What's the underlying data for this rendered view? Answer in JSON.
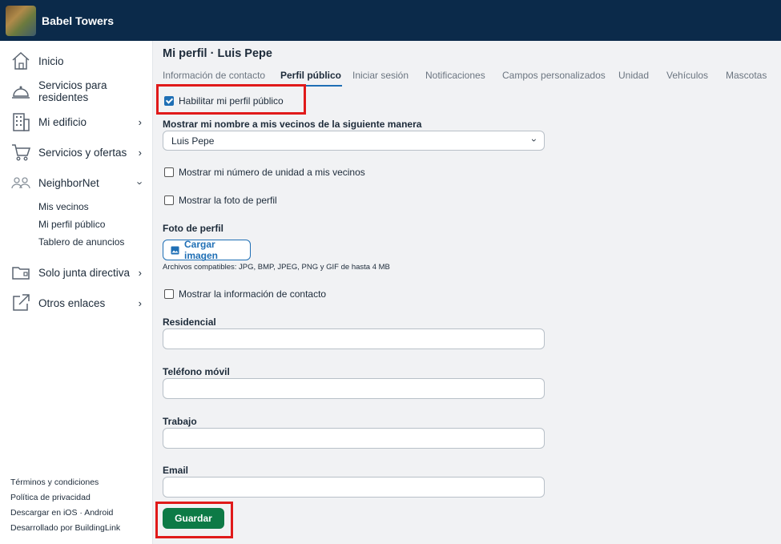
{
  "app": {
    "title": "Babel Towers"
  },
  "sidebar": {
    "items": [
      {
        "label": "Inicio",
        "icon": "home-icon"
      },
      {
        "label": "Servicios para residentes",
        "icon": "bell-icon"
      },
      {
        "label": "Mi edificio",
        "icon": "building-icon"
      },
      {
        "label": "Servicios y ofertas",
        "icon": "cart-icon"
      },
      {
        "label": "NeighborNet",
        "icon": "people-icon"
      },
      {
        "label": "Solo junta directiva",
        "icon": "folder-icon"
      },
      {
        "label": "Otros enlaces",
        "icon": "external-link-icon"
      }
    ],
    "subitems": [
      "Mis vecinos",
      "Mi perfil público",
      "Tablero de anuncios"
    ],
    "footer": [
      "Términos y condiciones",
      "Política de privacidad",
      "Descargar en iOS · Android",
      "Desarrollado por BuildingLink"
    ]
  },
  "page": {
    "title": "Mi perfil · Luis Pepe",
    "tabs": [
      "Información de contacto",
      "Perfil público",
      "Iniciar sesión",
      "Notificaciones",
      "Campos personalizados",
      "Unidad",
      "Vehículos",
      "Mascotas"
    ],
    "active_tab": "Perfil público"
  },
  "form": {
    "enable_profile": {
      "label": "Habilitar mi perfil público",
      "checked": true
    },
    "display_name": {
      "label": "Mostrar mi nombre a mis vecinos de la siguiente manera",
      "value": "Luis Pepe"
    },
    "show_unit": {
      "label": "Mostrar mi número de unidad a mis vecinos",
      "checked": false
    },
    "show_photo": {
      "label": "Mostrar la foto de perfil",
      "checked": false
    },
    "photo": {
      "label": "Foto de perfil",
      "button": "Cargar imagen",
      "hint": "Archivos compatibles: JPG, BMP, JPEG, PNG y GIF de hasta 4 MB"
    },
    "show_contact": {
      "label": "Mostrar la información de contacto",
      "checked": false
    },
    "residencial": {
      "label": "Residencial",
      "value": ""
    },
    "telefono": {
      "label": "Teléfono móvil",
      "value": ""
    },
    "trabajo": {
      "label": "Trabajo",
      "value": ""
    },
    "email": {
      "label": "Email",
      "value": ""
    },
    "save_label": "Guardar"
  },
  "colors": {
    "topbar": "#0b2a4a",
    "accent": "#1f6fb5",
    "save": "#0d7a46",
    "highlight": "#e01a1a"
  }
}
